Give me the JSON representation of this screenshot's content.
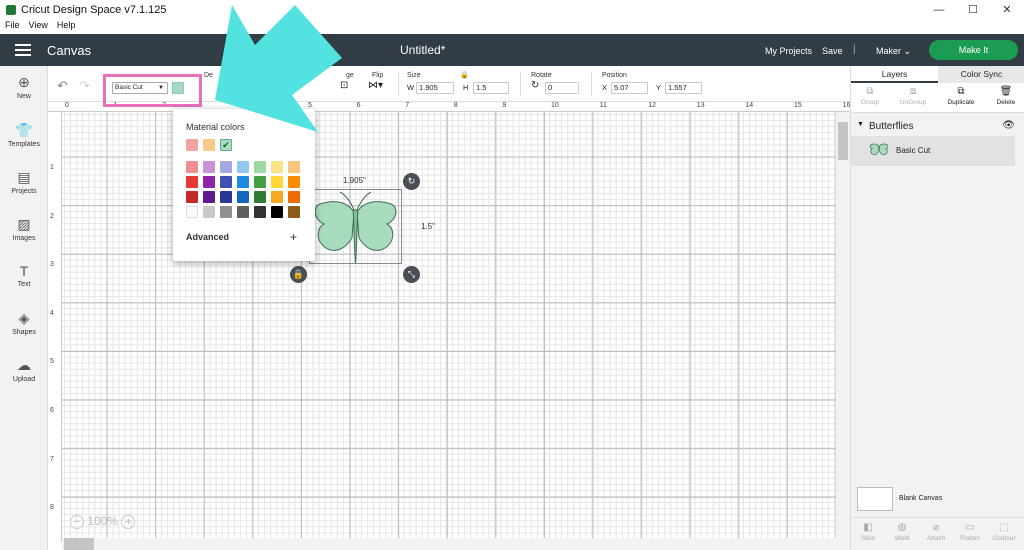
{
  "window": {
    "title": "Cricut Design Space  v7.1.125",
    "minimize": "—",
    "maximize": "☐",
    "close": "✕"
  },
  "menu": [
    "File",
    "View",
    "Help"
  ],
  "header": {
    "canvas_label": "Canvas",
    "doc_title": "Untitled*",
    "my_projects": "My Projects",
    "save": "Save",
    "separator": "|",
    "machine": "Maker",
    "make_it": "Make It"
  },
  "sidebar": [
    {
      "label": "New",
      "icon": "plus-circle-icon"
    },
    {
      "label": "Templates",
      "icon": "tshirt-icon"
    },
    {
      "label": "Projects",
      "icon": "notebook-icon"
    },
    {
      "label": "Images",
      "icon": "image-icon"
    },
    {
      "label": "Text",
      "icon": "text-icon"
    },
    {
      "label": "Shapes",
      "icon": "shapes-icon"
    },
    {
      "label": "Upload",
      "icon": "upload-icon"
    }
  ],
  "toolbar": {
    "operation_value": "Basic Cut",
    "material_color": "#a8dbbd",
    "labels": {
      "deselect": "De",
      "align": "ge",
      "flip": "Flip",
      "size": "Size",
      "rotate": "Rotate",
      "position": "Position"
    },
    "size": {
      "w_label": "W",
      "w": "1.905",
      "h_label": "H",
      "h": "1.5"
    },
    "rotate": "0",
    "position": {
      "x_label": "X",
      "x": "5.07",
      "y_label": "Y",
      "y": "1.557"
    }
  },
  "ruler": {
    "h": [
      "0",
      "1",
      "2",
      "",
      "",
      "5",
      "6",
      "7",
      "8",
      "9",
      "10",
      "11",
      "12",
      "13",
      "14",
      "15",
      "16"
    ],
    "v": [
      "1",
      "2",
      "3",
      "4",
      "5",
      "6",
      "7",
      "8"
    ]
  },
  "zoom": {
    "minus": "−",
    "value": "100%",
    "plus": "+"
  },
  "selection": {
    "width_label": "1.905\"",
    "height_label": "1.5\""
  },
  "popup": {
    "title": "Material colors",
    "recent": [
      "#f4a3a3",
      "#fbc98a",
      "#a8dbbd"
    ],
    "palette": [
      [
        "#ef8f91",
        "#c792d6",
        "#a3a8e2",
        "#8ec8ee",
        "#9dd8a2",
        "#f9e287",
        "#f9c47c"
      ],
      [
        "#e53935",
        "#8e24aa",
        "#3f51b5",
        "#1e88e5",
        "#43a047",
        "#fdd835",
        "#fb8c00"
      ],
      [
        "#c62828",
        "#5e1a91",
        "#283593",
        "#1565c0",
        "#2e7d32",
        "#f9a825",
        "#ef6c00"
      ],
      [
        "#ffffff",
        "#c8c8c8",
        "#8f8f8f",
        "#5f5f5f",
        "#333333",
        "#000000",
        "#8d5a1a"
      ]
    ],
    "advanced": "Advanced",
    "plus": "+"
  },
  "panel": {
    "tabs": [
      "Layers",
      "Color Sync"
    ],
    "actions": [
      {
        "label": "Group",
        "icon": "group-icon"
      },
      {
        "label": "UnGroup",
        "icon": "ungroup-icon"
      },
      {
        "label": "Duplicate",
        "icon": "duplicate-icon"
      },
      {
        "label": "Delete",
        "icon": "trash-icon"
      }
    ],
    "group_name": "Butterflies",
    "layer_name": "Basic Cut",
    "blank_canvas": "Blank Canvas",
    "bottom_actions": [
      {
        "label": "Slice",
        "icon": "slice-icon"
      },
      {
        "label": "Weld",
        "icon": "weld-icon"
      },
      {
        "label": "Attach",
        "icon": "attach-icon"
      },
      {
        "label": "Flatten",
        "icon": "flatten-icon"
      },
      {
        "label": "Contour",
        "icon": "contour-icon"
      }
    ]
  }
}
